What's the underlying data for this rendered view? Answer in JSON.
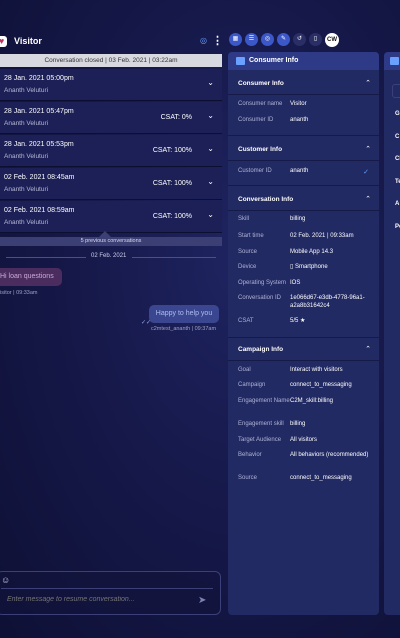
{
  "header": {
    "visitor_name": "Visitor"
  },
  "banner": "Conversation closed | 03 Feb. 2021 | 03:22am",
  "conversations": [
    {
      "date": "28 Jan. 2021 05:00pm",
      "agent": "Ananth Veluturi",
      "csat": ""
    },
    {
      "date": "28 Jan. 2021 05:47pm",
      "agent": "Ananth Veluturi",
      "csat": "CSAT: 0%"
    },
    {
      "date": "28 Jan. 2021 05:53pm",
      "agent": "Ananth Veluturi",
      "csat": "CSAT: 100%"
    },
    {
      "date": "02 Feb. 2021 08:45am",
      "agent": "Ananth Veluturi",
      "csat": "CSAT: 100%"
    },
    {
      "date": "02 Feb. 2021 08:59am",
      "agent": "Ananth Veluturi",
      "csat": "CSAT: 100%"
    }
  ],
  "previous_label": "5 previous conversations",
  "date_separator": "02 Feb. 2021",
  "messages": {
    "visitor_text": "Hi loan questions",
    "visitor_meta": "isitor  |  09:33am",
    "agent_text": "Happy to help you",
    "agent_meta": "c2mtest_ananth  |  09:37am"
  },
  "composer": {
    "placeholder": "Enter message to resume conversation..."
  },
  "toolbar": {
    "cw_label": "CW"
  },
  "consumer_panel": {
    "title": "Consumer Info",
    "consumer_info": {
      "title": "Consumer Info",
      "rows": [
        {
          "label": "Consumer name",
          "value": "Visitor"
        },
        {
          "label": "Consumer ID",
          "value": "ananth"
        }
      ]
    },
    "customer_info": {
      "title": "Customer Info",
      "rows": [
        {
          "label": "Customer ID",
          "value": "ananth"
        }
      ]
    },
    "conversation_info": {
      "title": "Conversation Info",
      "rows": [
        {
          "label": "Skill",
          "value": "billing"
        },
        {
          "label": "Start time",
          "value": "02 Feb. 2021 | 09:33am"
        },
        {
          "label": "Source",
          "value": "Mobile App 14.3"
        },
        {
          "label": "Device",
          "value": "Smartphone"
        },
        {
          "label": "Operating System",
          "value": "IOS"
        },
        {
          "label": "Conversation ID",
          "value": "1e066d67-e3db-4778-96a1-a2a8b31642c4"
        },
        {
          "label": "CSAT",
          "value": "5/5 ★"
        }
      ]
    },
    "campaign_info": {
      "title": "Campaign Info",
      "rows": [
        {
          "label": "Goal",
          "value": "Interact with visitors"
        },
        {
          "label": "Campaign",
          "value": "connect_to_messaging"
        },
        {
          "label": "Engagement Name",
          "value": "C2M_skill:billing"
        },
        {
          "label": "Engagement skill",
          "value": "billing"
        },
        {
          "label": "Target Audience",
          "value": "All visitors"
        },
        {
          "label": "Behavior",
          "value": "All behaviors (recommended)"
        },
        {
          "label": "Source",
          "value": "connect_to_messaging"
        }
      ]
    }
  },
  "right_panel": {
    "items": [
      "G",
      "C",
      "Cl",
      "Te",
      "A",
      "Pe"
    ]
  },
  "colors": {
    "accent": "#3b57c8",
    "panel": "#222a63",
    "verified": "#5aa0ff"
  }
}
